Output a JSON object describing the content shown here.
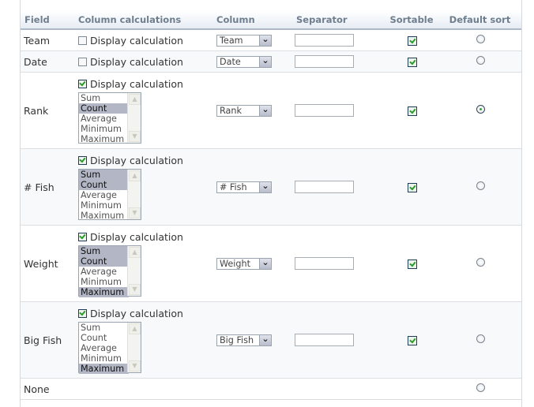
{
  "headers": {
    "field": "Field",
    "calculations": "Column calculations",
    "column": "Column",
    "separator": "Separator",
    "sortable": "Sortable",
    "default_sort": "Default sort"
  },
  "calc_label": "Display calculation",
  "calc_options": [
    "Sum",
    "Count",
    "Average",
    "Minimum",
    "Maximum"
  ],
  "rows": [
    {
      "field": "Team",
      "display_calc": false,
      "column": "Team",
      "separator": "",
      "sortable": true,
      "default_sort": false
    },
    {
      "field": "Date",
      "display_calc": false,
      "column": "Date",
      "separator": "",
      "sortable": true,
      "default_sort": false
    },
    {
      "field": "Rank",
      "display_calc": true,
      "selected_calcs": [
        "Count"
      ],
      "column": "Rank",
      "separator": "",
      "sortable": true,
      "default_sort": true
    },
    {
      "field": "# Fish",
      "display_calc": true,
      "selected_calcs": [
        "Sum",
        "Count"
      ],
      "column": "# Fish",
      "separator": "",
      "sortable": true,
      "default_sort": false
    },
    {
      "field": "Weight",
      "display_calc": true,
      "selected_calcs": [
        "Sum",
        "Count",
        "Maximum"
      ],
      "column": "Weight",
      "separator": "",
      "sortable": true,
      "default_sort": false
    },
    {
      "field": "Big Fish",
      "display_calc": true,
      "selected_calcs": [
        "Maximum"
      ],
      "column": "Big Fish",
      "separator": "",
      "sortable": true,
      "default_sort": false
    },
    {
      "field": "None",
      "default_sort": false
    }
  ],
  "icons": {
    "dropdown": "chevron-down-icon",
    "scroll_up": "chevron-up-icon",
    "scroll_down": "chevron-down-icon"
  },
  "colors": {
    "header_text": "#6f7e8e",
    "selected_option_bg": "#b3b6c4",
    "check_green": "#2c9a2c"
  }
}
